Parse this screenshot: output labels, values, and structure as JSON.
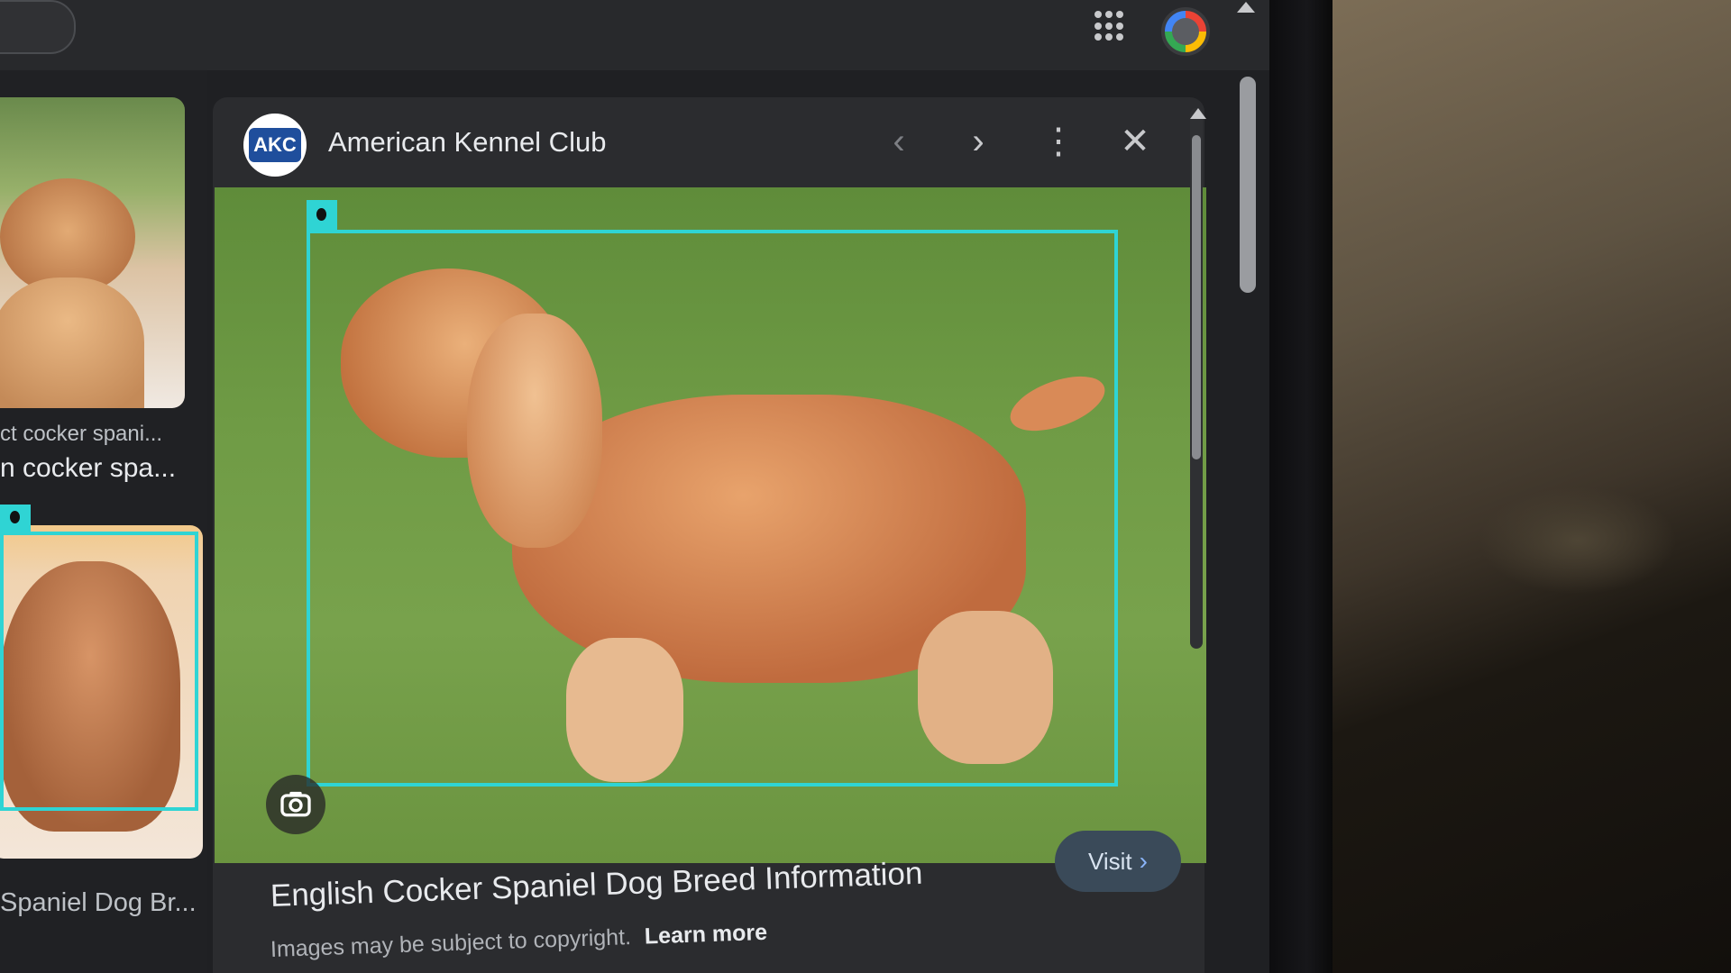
{
  "panel": {
    "site_logo_text": "AKC",
    "site_name": "American Kennel Club",
    "prev_label": "‹",
    "next_label": "›",
    "more_label": "⋮",
    "close_label": "✕",
    "title": "English Cocker Spaniel Dog Breed Information",
    "copyright_text": "Images may be subject to copyright.",
    "learn_more": "Learn more",
    "visit_label": "Visit",
    "visit_chevron": "›"
  },
  "results": {
    "item1_small": "ct cocker spani...",
    "item1_large": "n cocker spa...",
    "item2_caption": "Spaniel Dog Br..."
  },
  "colors": {
    "selection": "#2fd4d4",
    "panel_bg": "#2b2c2f",
    "link": "#8ab4f8"
  }
}
